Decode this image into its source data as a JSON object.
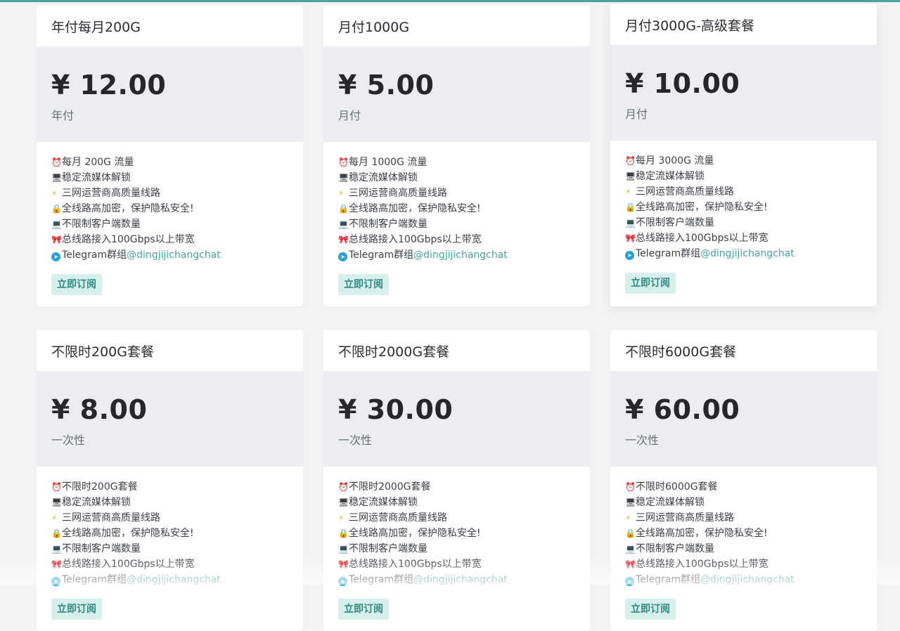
{
  "plans": [
    {
      "title": "年付每月200G",
      "price": "¥ 12.00",
      "period": "年付",
      "features": [
        {
          "icon": "alarm-clock-icon",
          "glyph": "⏰",
          "text": "每月 200G 流量"
        },
        {
          "icon": "monitor-icon",
          "glyph": "🖥",
          "text": "稳定流媒体解锁"
        },
        {
          "icon": "lightning-icon",
          "glyph": "⚡",
          "text": "三网运营商高质量线路"
        },
        {
          "icon": "lock-icon",
          "glyph": "🔒",
          "text": "全线路高加密，保护隐私安全!"
        },
        {
          "icon": "laptop-icon",
          "glyph": "💻",
          "text": "不限制客户端数量"
        },
        {
          "icon": "ribbon-icon",
          "glyph": "🎀",
          "text": "总线路接入100Gbps以上带宽"
        }
      ],
      "telegram_label": "Telegram群组",
      "telegram_handle": "@dingjijichangchat",
      "button": "立即订阅"
    },
    {
      "title": "月付1000G",
      "price": "¥ 5.00",
      "period": "月付",
      "features": [
        {
          "icon": "alarm-clock-icon",
          "glyph": "⏰",
          "text": "每月 1000G 流量"
        },
        {
          "icon": "monitor-icon",
          "glyph": "🖥",
          "text": "稳定流媒体解锁"
        },
        {
          "icon": "lightning-icon",
          "glyph": "⚡",
          "text": "三网运营商高质量线路"
        },
        {
          "icon": "lock-icon",
          "glyph": "🔒",
          "text": "全线路高加密，保护隐私安全!"
        },
        {
          "icon": "laptop-icon",
          "glyph": "💻",
          "text": "不限制客户端数量"
        },
        {
          "icon": "ribbon-icon",
          "glyph": "🎀",
          "text": "总线路接入100Gbps以上带宽"
        }
      ],
      "telegram_label": "Telegram群组",
      "telegram_handle": "@dingjijichangchat",
      "button": "立即订阅"
    },
    {
      "title": "月付3000G-高级套餐",
      "price": "¥ 10.00",
      "period": "月付",
      "features": [
        {
          "icon": "alarm-clock-icon",
          "glyph": "⏰",
          "text": "每月 3000G 流量"
        },
        {
          "icon": "monitor-icon",
          "glyph": "🖥",
          "text": "稳定流媒体解锁"
        },
        {
          "icon": "lightning-icon",
          "glyph": "⚡",
          "text": "三网运营商高质量线路"
        },
        {
          "icon": "lock-icon",
          "glyph": "🔒",
          "text": "全线路高加密，保护隐私安全!"
        },
        {
          "icon": "laptop-icon",
          "glyph": "💻",
          "text": "不限制客户端数量"
        },
        {
          "icon": "ribbon-icon",
          "glyph": "🎀",
          "text": "总线路接入100Gbps以上带宽"
        }
      ],
      "telegram_label": "Telegram群组",
      "telegram_handle": "@dingjijichangchat",
      "button": "立即订阅"
    },
    {
      "title": "不限时200G套餐",
      "price": "¥ 8.00",
      "period": "一次性",
      "features": [
        {
          "icon": "alarm-clock-icon",
          "glyph": "⏰",
          "text": "不限时200G套餐"
        },
        {
          "icon": "monitor-icon",
          "glyph": "🖥",
          "text": "稳定流媒体解锁"
        },
        {
          "icon": "lightning-icon",
          "glyph": "⚡",
          "text": "三网运营商高质量线路"
        },
        {
          "icon": "lock-icon",
          "glyph": "🔒",
          "text": "全线路高加密，保护隐私安全!"
        },
        {
          "icon": "laptop-icon",
          "glyph": "💻",
          "text": "不限制客户端数量"
        },
        {
          "icon": "ribbon-icon",
          "glyph": "🎀",
          "text": "总线路接入100Gbps以上带宽"
        }
      ],
      "telegram_label": "Telegram群组",
      "telegram_handle": "@dingjijichangchat",
      "button": "立即订阅"
    },
    {
      "title": "不限时2000G套餐",
      "price": "¥ 30.00",
      "period": "一次性",
      "features": [
        {
          "icon": "alarm-clock-icon",
          "glyph": "⏰",
          "text": "不限时2000G套餐"
        },
        {
          "icon": "monitor-icon",
          "glyph": "🖥",
          "text": "稳定流媒体解锁"
        },
        {
          "icon": "lightning-icon",
          "glyph": "⚡",
          "text": "三网运营商高质量线路"
        },
        {
          "icon": "lock-icon",
          "glyph": "🔒",
          "text": "全线路高加密，保护隐私安全!"
        },
        {
          "icon": "laptop-icon",
          "glyph": "💻",
          "text": "不限制客户端数量"
        },
        {
          "icon": "ribbon-icon",
          "glyph": "🎀",
          "text": "总线路接入100Gbps以上带宽"
        }
      ],
      "telegram_label": "Telegram群组",
      "telegram_handle": "@dingjijichangchat",
      "button": "立即订阅"
    },
    {
      "title": "不限时6000G套餐",
      "price": "¥ 60.00",
      "period": "一次性",
      "features": [
        {
          "icon": "alarm-clock-icon",
          "glyph": "⏰",
          "text": "不限时6000G套餐"
        },
        {
          "icon": "monitor-icon",
          "glyph": "🖥",
          "text": "稳定流媒体解锁"
        },
        {
          "icon": "lightning-icon",
          "glyph": "⚡",
          "text": "三网运营商高质量线路"
        },
        {
          "icon": "lock-icon",
          "glyph": "🔒",
          "text": "全线路高加密，保护隐私安全!"
        },
        {
          "icon": "laptop-icon",
          "glyph": "💻",
          "text": "不限制客户端数量"
        },
        {
          "icon": "ribbon-icon",
          "glyph": "🎀",
          "text": "总线路接入100Gbps以上带宽"
        }
      ],
      "telegram_label": "Telegram群组",
      "telegram_handle": "@dingjijichangchat",
      "button": "立即订阅"
    }
  ],
  "colors": {
    "accent": "#4aa39a",
    "button_bg": "#d6efec",
    "price_bg": "#ecedf0"
  }
}
